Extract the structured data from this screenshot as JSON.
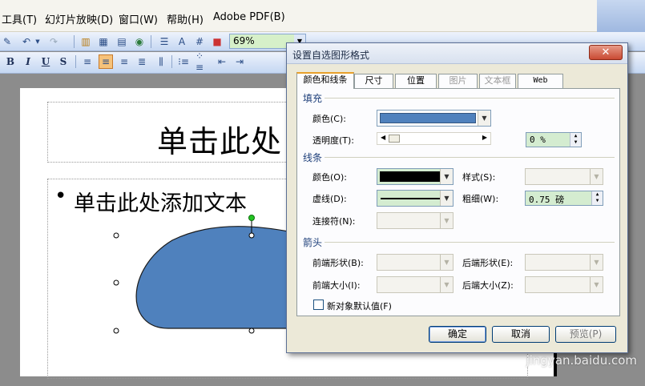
{
  "menu": {
    "items": [
      "工具(T)",
      "幻灯片放映(D)",
      "窗口(W)",
      "帮助(H)",
      "Adobe PDF(B)"
    ]
  },
  "toolbar": {
    "zoom_value": "69%",
    "format_buttons": [
      "B",
      "I",
      "U",
      "S"
    ]
  },
  "slide": {
    "title_placeholder": "单击此处",
    "body_placeholder": "单击此处添加文本",
    "bullet": "•",
    "shape_fill": "#4f81bd"
  },
  "dialog": {
    "title": "设置自选图形格式",
    "close_glyph": "✕",
    "tabs": [
      {
        "label": "颜色和线条",
        "active": true,
        "enabled": true
      },
      {
        "label": "尺寸",
        "active": false,
        "enabled": true
      },
      {
        "label": "位置",
        "active": false,
        "enabled": true
      },
      {
        "label": "图片",
        "active": false,
        "enabled": false
      },
      {
        "label": "文本框",
        "active": false,
        "enabled": false
      },
      {
        "label": "Web",
        "active": false,
        "enabled": true
      }
    ],
    "fill": {
      "section_label": "填充",
      "color_label": "颜色(C):",
      "color_value": "#4f81bd",
      "transparency_label": "透明度(T):",
      "transparency_value": "0 %"
    },
    "line": {
      "section_label": "线条",
      "color_label": "颜色(O):",
      "color_value": "#000000",
      "style_label": "样式(S):",
      "dashed_label": "虚线(D):",
      "weight_label": "粗细(W):",
      "weight_value": "0.75 磅",
      "connector_label": "连接符(N):"
    },
    "arrows": {
      "section_label": "箭头",
      "begin_style_label": "前端形状(B):",
      "end_style_label": "后端形状(E):",
      "begin_size_label": "前端大小(I):",
      "end_size_label": "后端大小(Z):"
    },
    "default_checkbox_label": "新对象默认值(F)",
    "ok_label": "确定",
    "cancel_label": "取消",
    "preview_label": "预览(P)"
  },
  "watermark": "jingyan.baidu.com"
}
